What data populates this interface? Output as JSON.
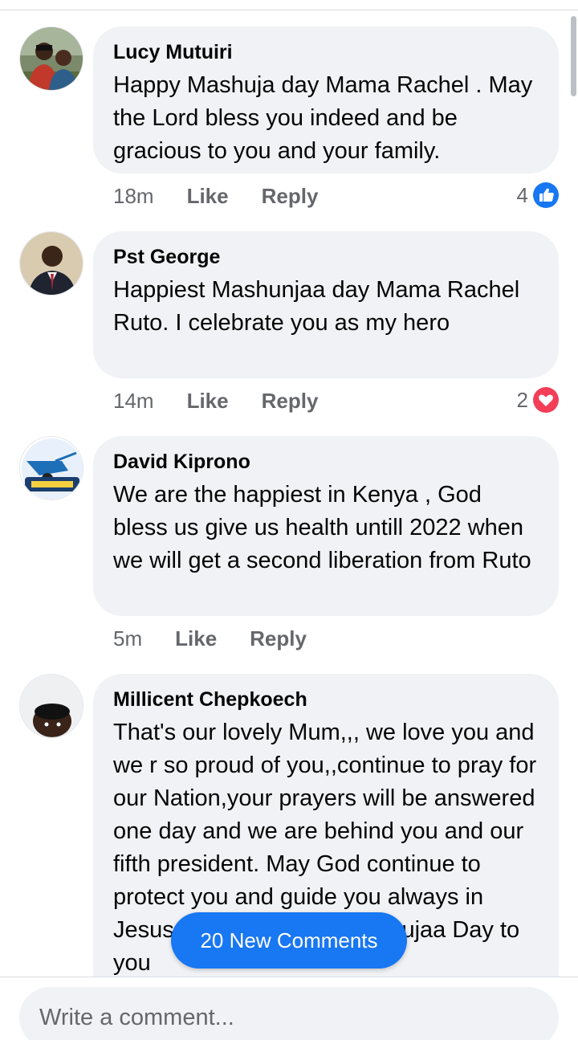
{
  "comments": [
    {
      "author": "Lucy Mutuiri",
      "text": "Happy Mashuja day Mama Rachel . May the Lord bless you indeed and be gracious to you and your family.",
      "time": "18m",
      "like_label": "Like",
      "reply_label": "Reply",
      "reaction_count": "4",
      "reaction_icon": "like-icon",
      "avatar_icon": "avatar-two-people"
    },
    {
      "author": "Pst George",
      "text": "Happiest Mashunjaa day Mama Rachel Ruto. I celebrate you as my hero",
      "time": "14m",
      "like_label": "Like",
      "reply_label": "Reply",
      "reaction_count": "2",
      "reaction_icon": "love-icon",
      "avatar_icon": "avatar-man-in-suit"
    },
    {
      "author": "David Kiprono",
      "text": "We are the happiest in Kenya , God bless us give us health untill 2022 when we will get a second liberation from Ruto",
      "time": "5m",
      "like_label": "Like",
      "reply_label": "Reply",
      "avatar_icon": "avatar-wheelbarrow-logo"
    },
    {
      "author": "Millicent Chepkoech",
      "text": "That's our lovely Mum,,, we love you and we r so proud of you,,continue to pray for our Nation,your prayers will be answered one day and we are behind you and our fifth president. May God continue to protect you and guide you always in Jesus name,,,, Happy Mashujaa Day to you",
      "avatar_icon": "avatar-woman"
    }
  ],
  "new_comments_label": "20 New Comments",
  "composer": {
    "placeholder": "Write a comment..."
  },
  "colors": {
    "accent": "#1877f2",
    "love": "#f33e58",
    "bubble": "#f0f2f5",
    "meta": "#65676b"
  }
}
